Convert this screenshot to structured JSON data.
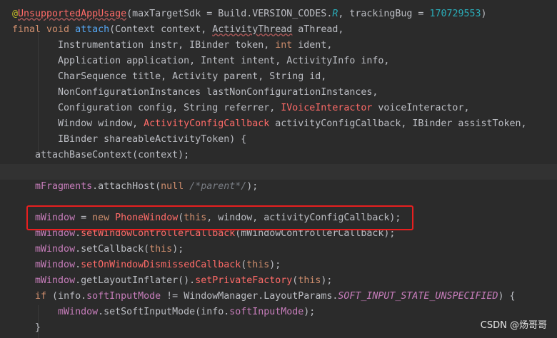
{
  "editor": {
    "highlight_color": "#e81f1f",
    "colors": {
      "plain": "#bcbec4",
      "annotation": "#bbb529",
      "keyword": "#cf8e6d",
      "method_decl": "#56a8f5",
      "field": "#c77dbb",
      "number": "#2aacb8",
      "deprecated": "#c77dbb",
      "comment": "#7a7e85",
      "error_type": "#ff6b68",
      "constant": "#c77dbb"
    },
    "lines": [
      [
        {
          "t": "@",
          "c": "annotation"
        },
        {
          "t": "UnsupportedAppUsage",
          "c": "error_type",
          "u": true
        },
        {
          "t": "(maxTargetSdk = Build.VERSION_CODES.",
          "c": "plain"
        },
        {
          "t": "R",
          "c": "number",
          "i": true
        },
        {
          "t": ", trackingBug = ",
          "c": "plain"
        },
        {
          "t": "170729553",
          "c": "number"
        },
        {
          "t": ")",
          "c": "plain"
        }
      ],
      [
        {
          "t": "final void ",
          "c": "keyword"
        },
        {
          "t": "attach",
          "c": "method_decl"
        },
        {
          "t": "(Context context, ",
          "c": "plain"
        },
        {
          "t": "ActivityThread",
          "c": "plain",
          "u": true
        },
        {
          "t": " aThread,",
          "c": "plain"
        }
      ],
      [
        {
          "t": "        Instrumentation instr, IBinder token, ",
          "c": "plain"
        },
        {
          "t": "int",
          "c": "keyword"
        },
        {
          "t": " ident,",
          "c": "plain"
        }
      ],
      [
        {
          "t": "        Application application, Intent intent, ActivityInfo info,",
          "c": "plain"
        }
      ],
      [
        {
          "t": "        CharSequence title, Activity parent, String id,",
          "c": "plain"
        }
      ],
      [
        {
          "t": "        NonConfigurationInstances lastNonConfigurationInstances,",
          "c": "plain"
        }
      ],
      [
        {
          "t": "        Configuration config, String referrer, ",
          "c": "plain"
        },
        {
          "t": "IVoiceInteractor",
          "c": "error_type"
        },
        {
          "t": " voiceInteractor,",
          "c": "plain"
        }
      ],
      [
        {
          "t": "        Window window, ",
          "c": "plain"
        },
        {
          "t": "ActivityConfigCallback",
          "c": "error_type"
        },
        {
          "t": " activityConfigCallback, IBinder assistToken,",
          "c": "plain"
        }
      ],
      [
        {
          "t": "        IBinder shareableActivityToken) {",
          "c": "plain"
        }
      ],
      [
        {
          "t": "    attachBaseContext(context);",
          "c": "plain"
        }
      ],
      [],
      [
        {
          "t": "    ",
          "c": "plain"
        },
        {
          "t": "mFragments",
          "c": "field"
        },
        {
          "t": ".attachHost(",
          "c": "plain"
        },
        {
          "t": "null",
          "c": "keyword"
        },
        {
          "t": " ",
          "c": "plain"
        },
        {
          "t": "/*parent*/",
          "c": "comment",
          "i": true
        },
        {
          "t": ");",
          "c": "plain"
        }
      ],
      [],
      [
        {
          "t": "    ",
          "c": "plain"
        },
        {
          "t": "mWindow",
          "c": "field"
        },
        {
          "t": " = ",
          "c": "plain"
        },
        {
          "t": "new ",
          "c": "keyword"
        },
        {
          "t": "PhoneWindow",
          "c": "error_type"
        },
        {
          "t": "(",
          "c": "plain"
        },
        {
          "t": "this",
          "c": "keyword"
        },
        {
          "t": ", window, activityConfigCallback);",
          "c": "plain"
        }
      ],
      [
        {
          "t": "    ",
          "c": "plain"
        },
        {
          "t": "mWindow",
          "c": "field"
        },
        {
          "t": ".",
          "c": "plain"
        },
        {
          "t": "setWindowControllerCallback",
          "c": "error_type"
        },
        {
          "t": "(mWindowControllerCallback);",
          "c": "plain"
        }
      ],
      [
        {
          "t": "    ",
          "c": "plain"
        },
        {
          "t": "mWindow",
          "c": "field"
        },
        {
          "t": ".setCallback(",
          "c": "plain"
        },
        {
          "t": "this",
          "c": "keyword"
        },
        {
          "t": ");",
          "c": "plain"
        }
      ],
      [
        {
          "t": "    ",
          "c": "plain"
        },
        {
          "t": "mWindow",
          "c": "field"
        },
        {
          "t": ".",
          "c": "plain"
        },
        {
          "t": "setOnWindowDismissedCallback",
          "c": "error_type"
        },
        {
          "t": "(",
          "c": "plain"
        },
        {
          "t": "this",
          "c": "keyword"
        },
        {
          "t": ");",
          "c": "plain"
        }
      ],
      [
        {
          "t": "    ",
          "c": "plain"
        },
        {
          "t": "mWindow",
          "c": "field"
        },
        {
          "t": ".getLayoutInflater().",
          "c": "plain"
        },
        {
          "t": "setPrivateFactory",
          "c": "error_type"
        },
        {
          "t": "(",
          "c": "plain"
        },
        {
          "t": "this",
          "c": "keyword"
        },
        {
          "t": ");",
          "c": "plain"
        }
      ],
      [
        {
          "t": "    ",
          "c": "plain"
        },
        {
          "t": "if",
          "c": "keyword"
        },
        {
          "t": " (info.",
          "c": "plain"
        },
        {
          "t": "softInputMode",
          "c": "field"
        },
        {
          "t": " != WindowManager.LayoutParams.",
          "c": "plain"
        },
        {
          "t": "SOFT_INPUT_STATE_UNSPECIFIED",
          "c": "constant",
          "i": true
        },
        {
          "t": ") {",
          "c": "plain"
        }
      ],
      [
        {
          "t": "        ",
          "c": "plain"
        },
        {
          "t": "mWindow",
          "c": "field"
        },
        {
          "t": ".setSoftInputMode(info.",
          "c": "plain"
        },
        {
          "t": "softInputMode",
          "c": "field"
        },
        {
          "t": ");",
          "c": "plain"
        }
      ],
      [
        {
          "t": "    }",
          "c": "plain"
        }
      ]
    ]
  },
  "watermark": {
    "text": "CSDN @炀哥哥"
  }
}
